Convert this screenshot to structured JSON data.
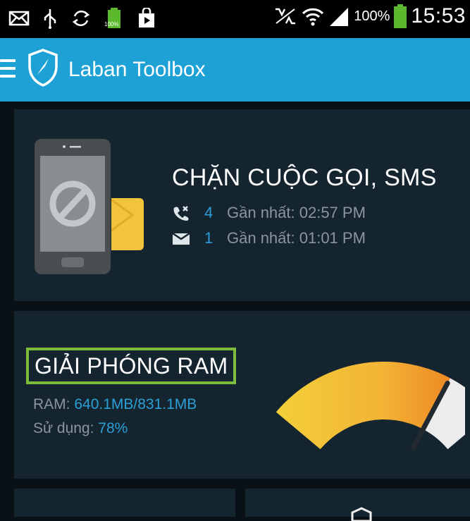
{
  "status_bar": {
    "battery_percent": "100%",
    "time": "15:53",
    "mini_battery_label": "100%"
  },
  "app_bar": {
    "title": "Laban Toolbox"
  },
  "block_card": {
    "title": "CHẶN CUỘC GỌI, SMS",
    "calls": {
      "count": "4",
      "label": "Gần nhất: 02:57 PM"
    },
    "sms": {
      "count": "1",
      "label": "Gần nhất: 01:01 PM"
    }
  },
  "ram_card": {
    "title": "GIẢI PHÓNG RAM",
    "ram_label": "RAM: ",
    "ram_value": "640.1MB/831.1MB",
    "usage_label": "Sử dụng: ",
    "usage_value": "78%",
    "usage_fraction": 0.78
  },
  "colors": {
    "app_bar": "#1ea2d6",
    "card_bg": "#152530",
    "accent_blue": "#2a9fd8",
    "highlight_green": "#7dbc3c"
  }
}
